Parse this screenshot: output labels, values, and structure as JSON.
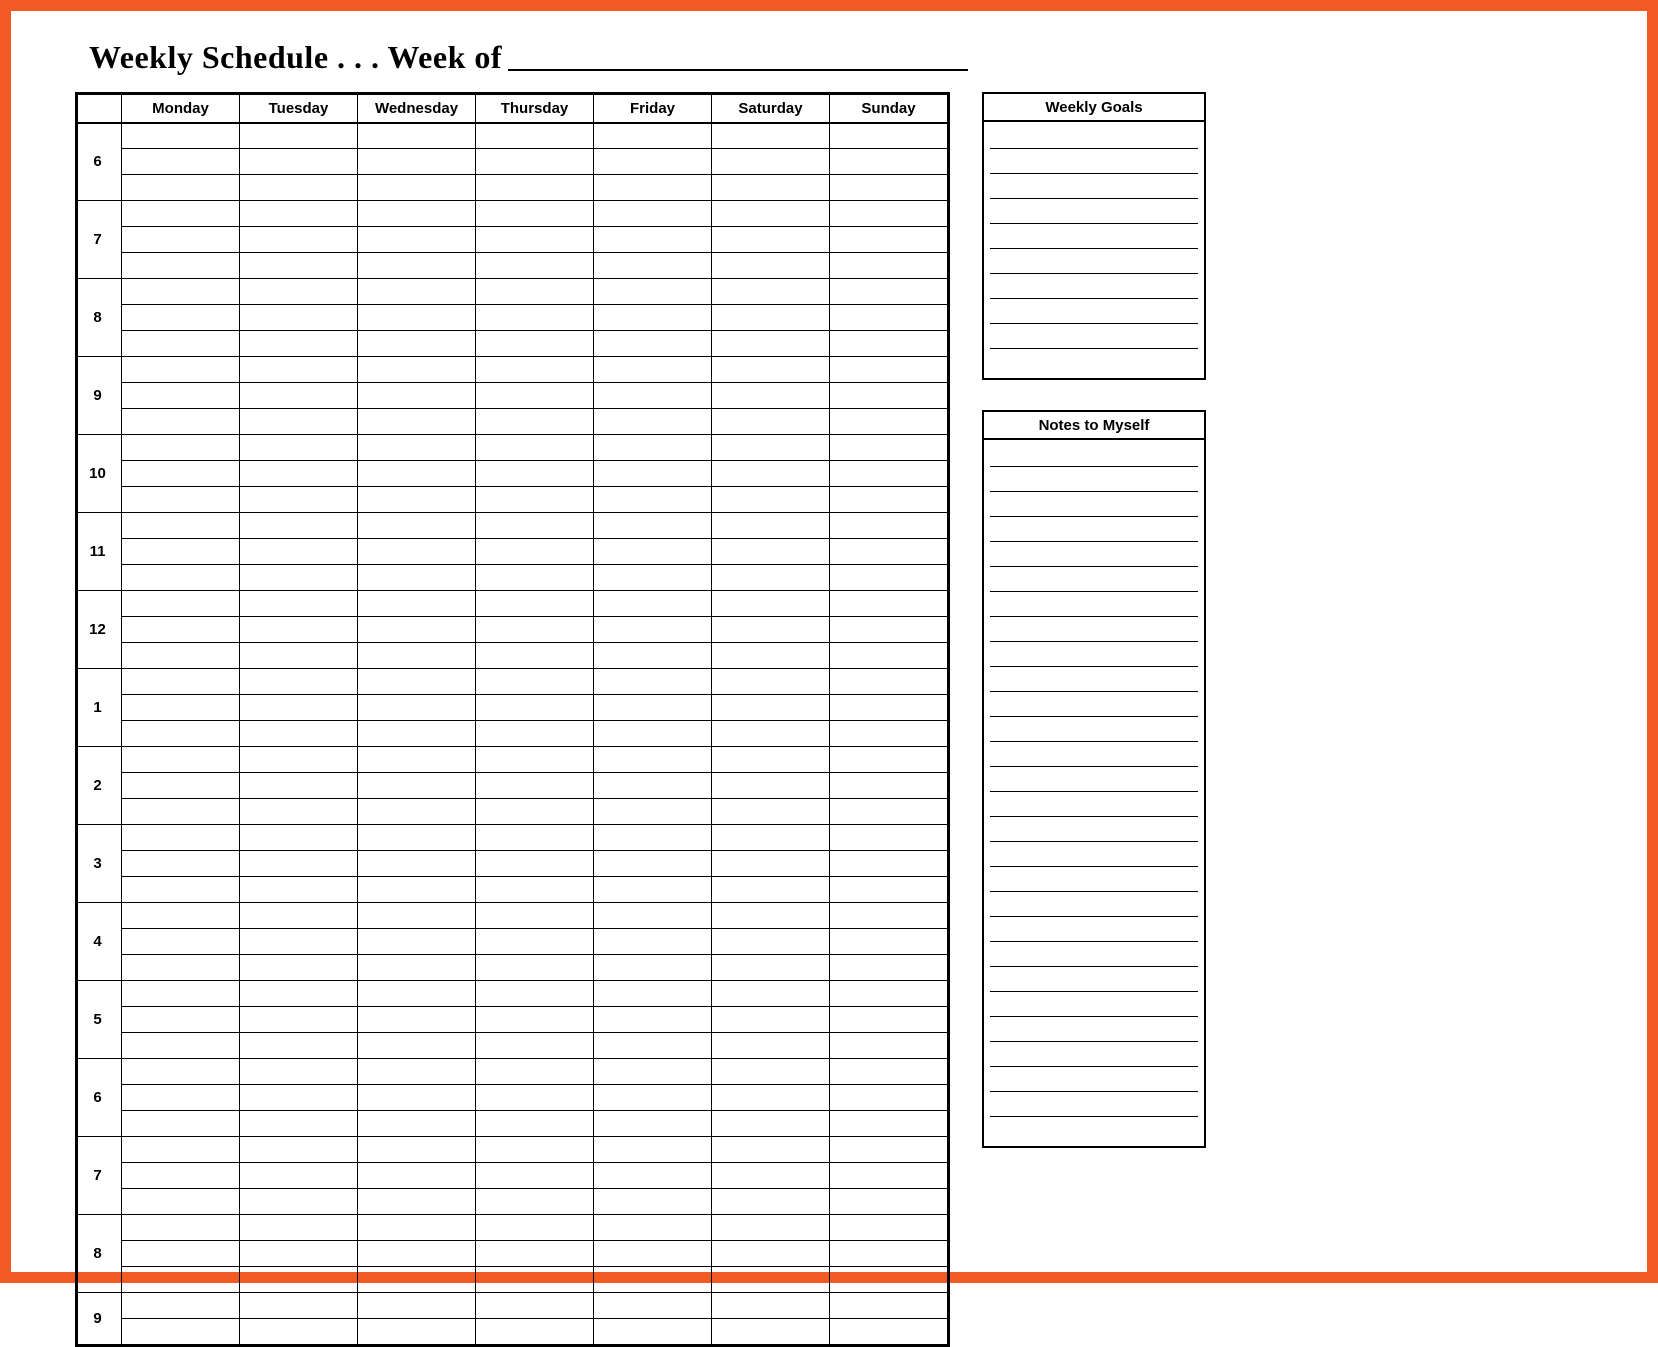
{
  "title": "Weekly Schedule . . . Week of",
  "days": [
    "Monday",
    "Tuesday",
    "Wednesday",
    "Thursday",
    "Friday",
    "Saturday",
    "Sunday"
  ],
  "times": [
    "6",
    "7",
    "8",
    "9",
    "10",
    "11",
    "12",
    "1",
    "2",
    "3",
    "4",
    "5",
    "6",
    "7",
    "8",
    "9"
  ],
  "subrows_per_time": 3,
  "goals": {
    "header": "Weekly Goals",
    "lines": 10
  },
  "notes": {
    "header": "Notes to Myself",
    "lines": 28
  }
}
